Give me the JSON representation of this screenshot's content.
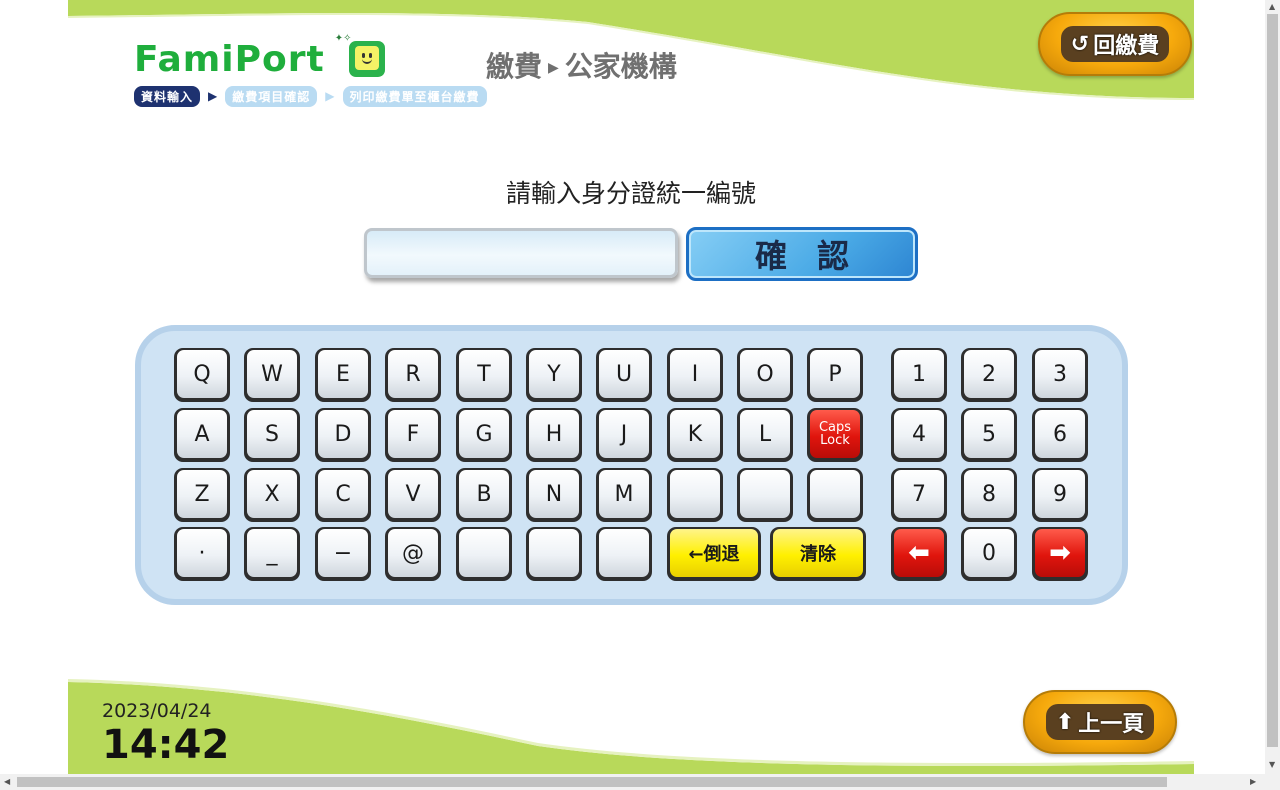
{
  "header": {
    "brand": "FamiPort",
    "title_part1": "繳費",
    "title_sep": "▶",
    "title_part2": "公家機構",
    "steps": [
      "資料輸入",
      "繳費項目確認",
      "列印繳費單至櫃台繳費"
    ],
    "step_arrow": "▶",
    "back_pay_label": "回繳費"
  },
  "main": {
    "prompt": "請輸入身分證統一編號",
    "input_value": "",
    "confirm_label": "確認"
  },
  "keyboard": {
    "row1": [
      "Q",
      "W",
      "E",
      "R",
      "T",
      "Y",
      "U",
      "I",
      "O",
      "P"
    ],
    "row2": [
      "A",
      "S",
      "D",
      "F",
      "G",
      "H",
      "J",
      "K",
      "L"
    ],
    "caps_lock": "Caps Lock",
    "row3": [
      "Z",
      "X",
      "C",
      "V",
      "B",
      "N",
      "M",
      "",
      "",
      ""
    ],
    "row4": [
      "·",
      "_",
      "−",
      "@",
      "",
      "",
      ""
    ],
    "backspace": "←倒退",
    "clear": "清除",
    "num_row1": [
      "1",
      "2",
      "3"
    ],
    "num_row2": [
      "4",
      "5",
      "6"
    ],
    "num_row3": [
      "7",
      "8",
      "9"
    ],
    "zero": "0",
    "left_arrow_icon": "left-arrow-icon",
    "right_arrow_icon": "right-arrow-icon"
  },
  "footer": {
    "date": "2023/04/24",
    "time": "14:42",
    "prev_page_label": "上一頁"
  },
  "colors": {
    "brand_green": "#1fae3c",
    "header_green": "#b8d95a",
    "keyboard_bg": "#cfe3f4",
    "yellow_key": "#fff000",
    "red_key": "#e0150d",
    "confirm_blue": "#4aaae6"
  }
}
